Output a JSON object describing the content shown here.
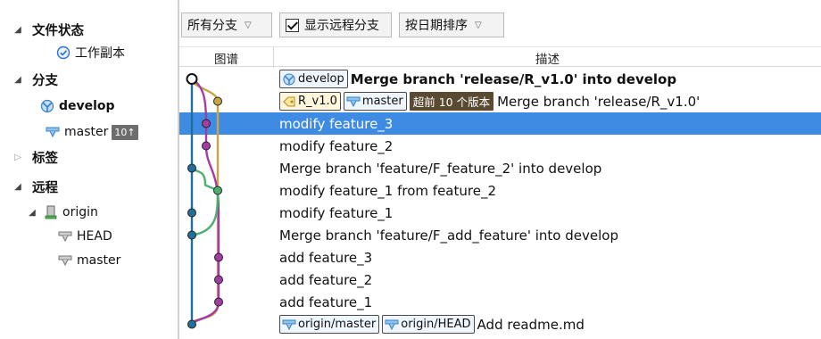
{
  "sidebar": {
    "file_status": "文件状态",
    "working_copy": "工作副本",
    "branches": "分支",
    "develop": "develop",
    "master": "master",
    "master_ahead": "10↑",
    "tags": "标签",
    "remotes": "远程",
    "origin": "origin",
    "head": "HEAD",
    "remote_master": "master"
  },
  "toolbar": {
    "branch_filter": "所有分支",
    "show_remote": "显示远程分支",
    "sort_order": "按日期排序"
  },
  "grid": {
    "graph_header": "图谱",
    "desc_header": "描述"
  },
  "commits": [
    {
      "refs": [
        {
          "label": "develop",
          "kind": "branch"
        }
      ],
      "message": "Merge branch 'release/R_v1.0' into develop",
      "bold": true
    },
    {
      "refs": [
        {
          "label": "R_v1.0",
          "kind": "tag"
        },
        {
          "label": "master",
          "kind": "branch"
        }
      ],
      "ahead": "超前 10 个版本",
      "message": "Merge branch 'release/R_v1.0'"
    },
    {
      "refs": [],
      "message": "modify feature_3",
      "selected": true
    },
    {
      "refs": [],
      "message": "modify feature_2"
    },
    {
      "refs": [],
      "message": "Merge branch 'feature/F_feature_2' into develop"
    },
    {
      "refs": [],
      "message": "modify feature_1 from feature_2"
    },
    {
      "refs": [],
      "message": "modify feature_1"
    },
    {
      "refs": [],
      "message": "Merge branch 'feature/F_add_feature' into develop"
    },
    {
      "refs": [],
      "message": "add feature_3"
    },
    {
      "refs": [],
      "message": "add feature_2"
    },
    {
      "refs": [],
      "message": "add feature_1"
    },
    {
      "refs": [
        {
          "label": "origin/master",
          "kind": "branch"
        },
        {
          "label": "origin/HEAD",
          "kind": "branch"
        }
      ],
      "message": "Add readme.md"
    }
  ],
  "graph_colors": {
    "develop": "#1f6f9a",
    "master": "#c8a447",
    "feature3": "#a43ca4",
    "feature2": "#4caf6d"
  }
}
